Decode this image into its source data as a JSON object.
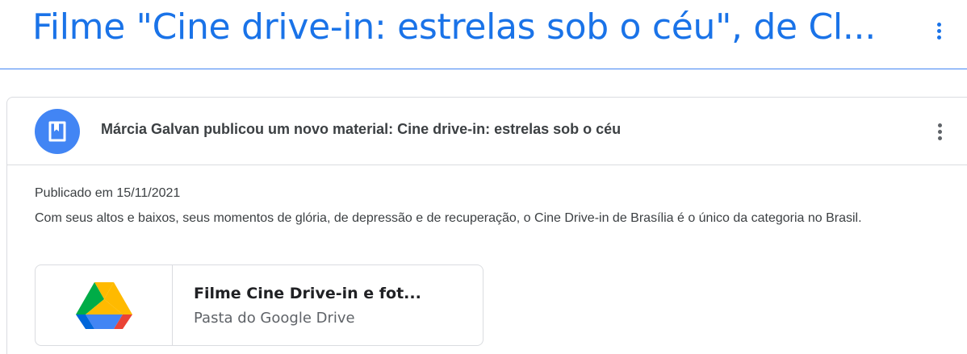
{
  "header": {
    "title": "Filme \"Cine drive-in: estrelas sob o céu\", de Cl...",
    "menu_icon": "more-vert-icon",
    "accent_color": "#1a73e8"
  },
  "post": {
    "avatar_icon": "bookmark-icon",
    "announcement": "Márcia Galvan publicou um novo material: Cine drive-in: estrelas sob o céu",
    "menu_icon": "more-vert-icon",
    "posted_date": "Publicado em 15/11/2021",
    "description": "Com seus altos e baixos, seus momentos de glória, de depressão e de recuperação, o Cine Drive-in de Brasília é o único da categoria no Brasil.",
    "attachment": {
      "icon": "google-drive-icon",
      "title": "Filme Cine Drive-in e fot...",
      "subtitle": "Pasta do Google Drive"
    }
  }
}
